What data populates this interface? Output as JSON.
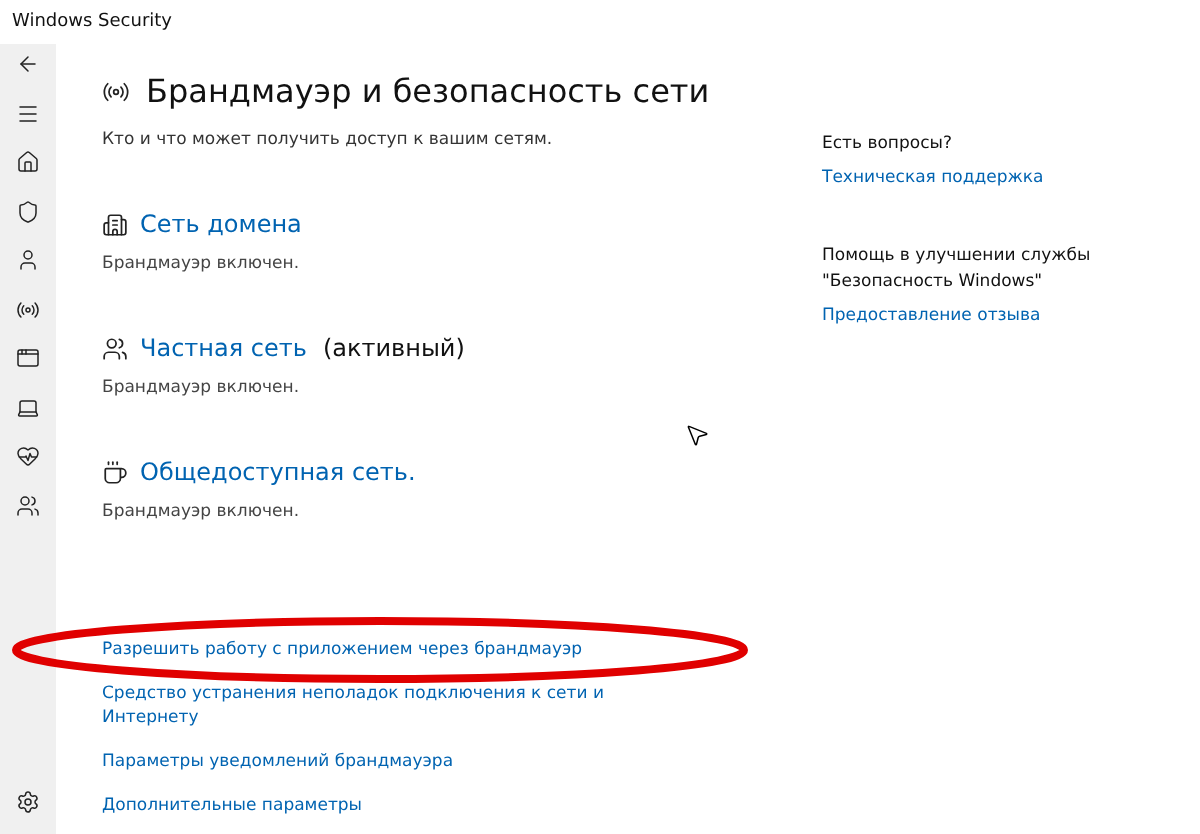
{
  "window": {
    "title": "Windows Security"
  },
  "header": {
    "title": "Брандмауэр и безопасность сети",
    "subtitle": "Кто и что может получить доступ к вашим сетям."
  },
  "networks": [
    {
      "kind": "domain",
      "name": "Сеть домена",
      "status": "Брандмауэр включен."
    },
    {
      "kind": "private",
      "name": "Частная сеть",
      "badge": "(активный)",
      "status": "Брандмауэр включен."
    },
    {
      "kind": "public",
      "name": "Общедоступная сеть.",
      "status": "Брандмауэр включен."
    }
  ],
  "links": [
    {
      "label": "Разрешить работу с приложением через брандмауэр",
      "circled": true
    },
    {
      "label": "Средство устранения неполадок подключения к сети и Интернету",
      "circled": false
    },
    {
      "label": "Параметры уведомлений брандмауэра",
      "circled": false
    },
    {
      "label": "Дополнительные параметры",
      "circled": false
    }
  ],
  "aside": [
    {
      "question": "Есть вопросы?",
      "link": "Техническая поддержка"
    },
    {
      "question": "Помощь в улучшении службы \"Безопасность Windows\"",
      "link": "Предоставление отзыва"
    }
  ]
}
